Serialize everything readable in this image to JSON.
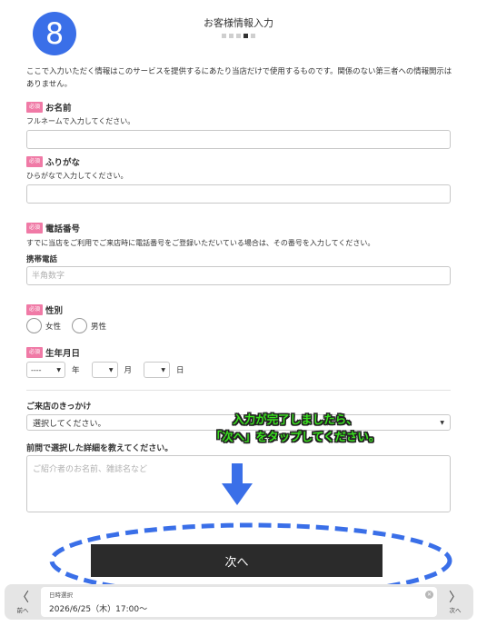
{
  "header": {
    "step_number": "8",
    "title": "お客様情報入力",
    "progress_total_steps": 5,
    "progress_current_step": 4
  },
  "intro_text": "ここで入力いただく情報はこのサービスを提供するにあたり当店だけで使用するものです。関係のない第三者への情報開示はありません。",
  "required_badge": "必須",
  "fields": {
    "name": {
      "label": "お名前",
      "hint": "フルネームで入力してください。",
      "value": ""
    },
    "kana": {
      "label": "ふりがな",
      "hint": "ひらがなで入力してください。",
      "value": ""
    },
    "phone": {
      "label": "電話番号",
      "hint": "すでに当店をご利用でご来店時に電話番号をご登録いただいている場合は、その番号を入力してください。",
      "mobile_label": "携帯電話",
      "placeholder": "半角数字"
    },
    "gender": {
      "label": "性別",
      "options": [
        "女性",
        "男性"
      ]
    },
    "birthdate": {
      "label": "生年月日",
      "year_value": "----",
      "month_value": "",
      "day_value": "",
      "year_unit": "年",
      "month_unit": "月",
      "day_unit": "日"
    },
    "reason": {
      "label": "ご来店のきっかけ",
      "value": "選択してください。"
    },
    "detail": {
      "label": "前問で選択した詳細を教えてください。",
      "placeholder": "ご紹介者のお名前、雑誌名など"
    }
  },
  "annotation": {
    "line1": "入力が完了しましたら、",
    "line2": "「次へ」をタップしてください。",
    "text_color": "#39e01e",
    "arrow_color": "#3a6fe8"
  },
  "next_button": {
    "label": "次へ"
  },
  "bottom_bar": {
    "prev_label": "前へ",
    "next_label": "次へ",
    "date_label": "日時選択",
    "date_value": "2026/6/25（木）17:00〜"
  },
  "colors": {
    "accent": "#3a6fe8",
    "required_badge": "#f07aa6",
    "button": "#2b2b2b"
  }
}
